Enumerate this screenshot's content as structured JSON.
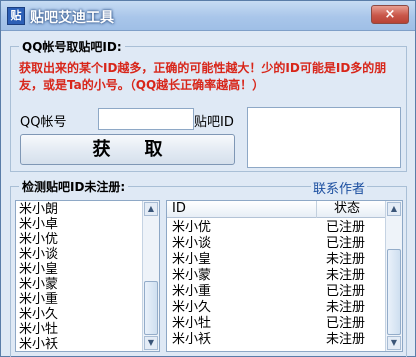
{
  "window": {
    "title": "贴吧艾迪工具",
    "icon_glyph": "贴",
    "close_glyph": "×"
  },
  "qq_group": {
    "label": "QQ帐号取贴吧ID:",
    "warning": "获取出来的某个ID越多，正确的可能性越大！少的ID可能是ID多的朋友，或是Ta的小号。（QQ越长正确率越高！）",
    "qq_label": "QQ帐号",
    "qq_value": "",
    "tieba_id_label": "贴吧ID",
    "fetch_button": "获取"
  },
  "check_group": {
    "label": "检测贴吧ID未注册:",
    "contact_link": "联系作者"
  },
  "name_list": [
    "米小朗",
    "米小卓",
    "米小优",
    "米小谈",
    "米小皇",
    "米小蒙",
    "米小重",
    "米小久",
    "米小牡",
    "米小袄"
  ],
  "result_table": {
    "columns": [
      "ID",
      "状态"
    ],
    "rows": [
      {
        "id": "米小优",
        "status": "已注册"
      },
      {
        "id": "米小谈",
        "status": "已注册"
      },
      {
        "id": "米小皇",
        "status": "未注册"
      },
      {
        "id": "米小蒙",
        "status": "未注册"
      },
      {
        "id": "米小重",
        "status": "已注册"
      },
      {
        "id": "米小久",
        "status": "未注册"
      },
      {
        "id": "米小牡",
        "status": "已注册"
      },
      {
        "id": "米小袄",
        "status": "未注册"
      }
    ]
  },
  "colors": {
    "warning": "#d8261a",
    "link": "#1c4fa0",
    "window_bg": "#dfe9f5"
  },
  "icons": {
    "scroll_up": "chevron-up-icon",
    "scroll_down": "chevron-down-icon"
  }
}
